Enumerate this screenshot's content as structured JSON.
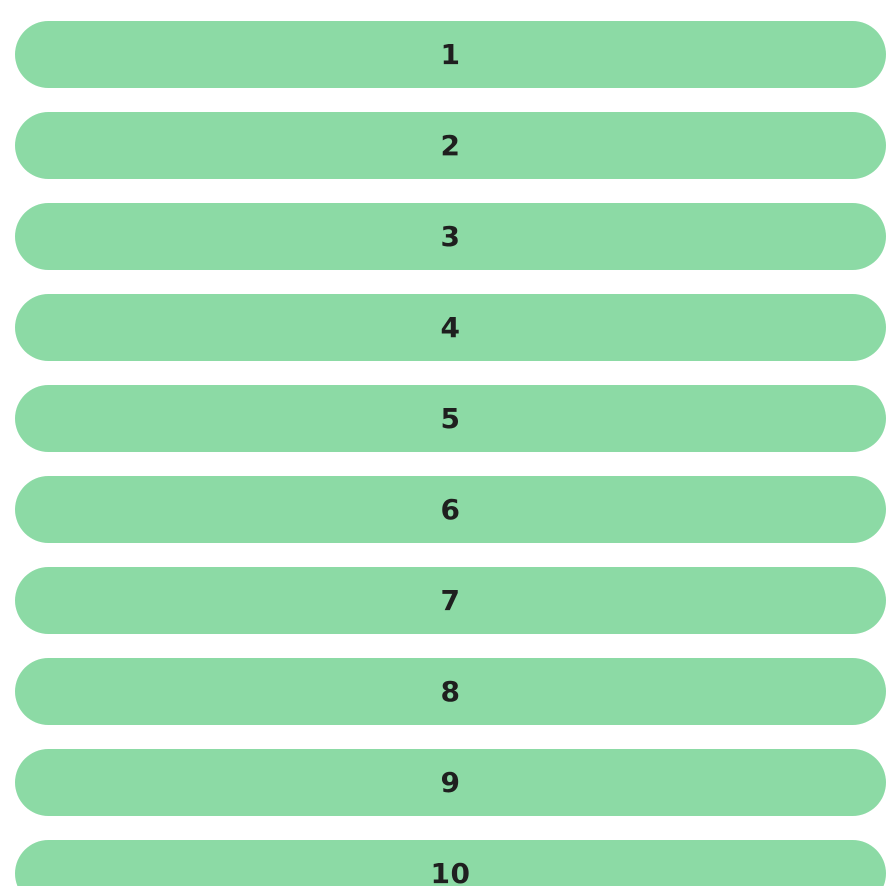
{
  "colors": {
    "pill_background": "#8cdaa5",
    "label_text": "#1f1f1f",
    "page_background": "#ffffff"
  },
  "items": [
    {
      "label": "1"
    },
    {
      "label": "2"
    },
    {
      "label": "3"
    },
    {
      "label": "4"
    },
    {
      "label": "5"
    },
    {
      "label": "6"
    },
    {
      "label": "7"
    },
    {
      "label": "8"
    },
    {
      "label": "9"
    },
    {
      "label": "10"
    }
  ]
}
